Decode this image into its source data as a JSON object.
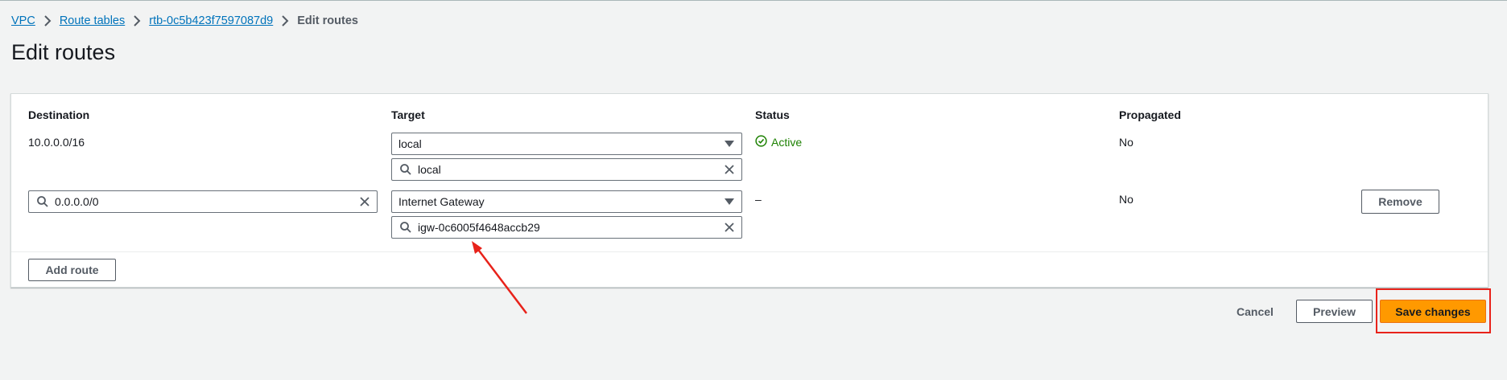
{
  "breadcrumb": {
    "items": [
      "VPC",
      "Route tables",
      "rtb-0c5b423f7597087d9"
    ],
    "current": "Edit routes"
  },
  "page": {
    "title": "Edit routes"
  },
  "table": {
    "headers": {
      "destination": "Destination",
      "target": "Target",
      "status": "Status",
      "propagated": "Propagated"
    },
    "routes": [
      {
        "destination": "10.0.0.0/16",
        "target_type": "local",
        "target_value": "local",
        "status": "Active",
        "propagated": "No"
      },
      {
        "destination": "0.0.0.0/0",
        "target_type": "Internet Gateway",
        "target_value": "igw-0c6005f4648accb29",
        "status": "–",
        "propagated": "No",
        "remove_label": "Remove"
      }
    ],
    "add_route_label": "Add route"
  },
  "footer": {
    "cancel_label": "Cancel",
    "preview_label": "Preview",
    "save_label": "Save changes"
  },
  "colors": {
    "primary": "#ff9900",
    "link": "#0073bb",
    "status_active": "#1d8102",
    "annotation": "#e8221a"
  },
  "icons": [
    "chevron-right-icon",
    "caret-down-icon",
    "search-icon",
    "clear-icon",
    "status-success-icon"
  ]
}
